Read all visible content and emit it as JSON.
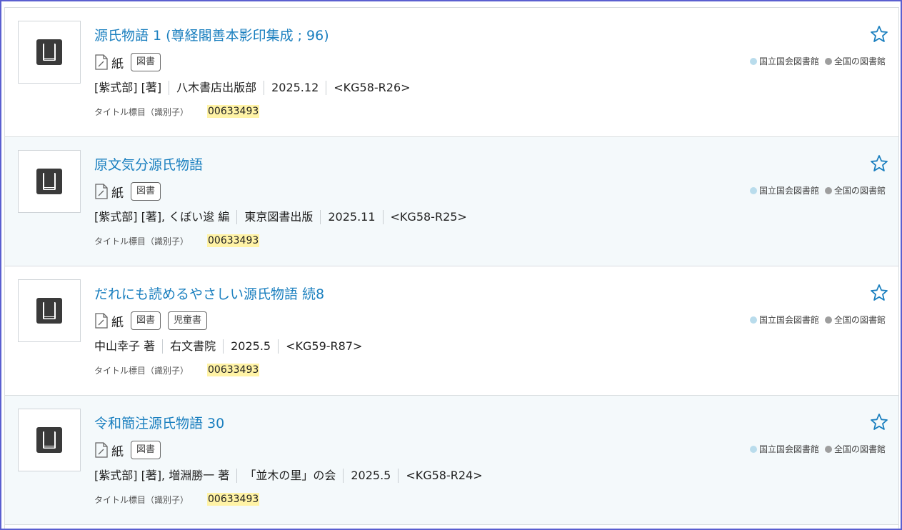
{
  "colors": {
    "title": "#1a7fbf",
    "ndl_dot": "#b9dcec",
    "all_dot": "#9e9e9e",
    "highlight": "#fff3a6",
    "star": "#1a7fbf"
  },
  "labels": {
    "paper": "紙",
    "ident_label": "タイトル標目（識別子）",
    "holding_ndl": "国立国会図書館",
    "holding_all": "全国の図書館"
  },
  "items": [
    {
      "title": "源氏物語 1 (尊経閣善本影印集成 ; 96)",
      "badges": [
        "図書"
      ],
      "author": "[紫式部] [著]",
      "publisher": "八木書店出版部",
      "date": "2025.12",
      "call": "<KG58-R26>",
      "ident": "00633493"
    },
    {
      "title": "原文気分源氏物語",
      "badges": [
        "図書"
      ],
      "author": "[紫式部] [著], くぼい逡 編",
      "publisher": "東京図書出版",
      "date": "2025.11",
      "call": "<KG58-R25>",
      "ident": "00633493"
    },
    {
      "title": "だれにも読めるやさしい源氏物語 続8",
      "badges": [
        "図書",
        "児童書"
      ],
      "author": "中山幸子 著",
      "publisher": "右文書院",
      "date": "2025.5",
      "call": "<KG59-R87>",
      "ident": "00633493"
    },
    {
      "title": "令和簡注源氏物語 30",
      "badges": [
        "図書"
      ],
      "author": "[紫式部] [著], 増淵勝一 著",
      "publisher": "「並木の里」の会",
      "date": "2025.5",
      "call": "<KG58-R24>",
      "ident": "00633493"
    }
  ]
}
